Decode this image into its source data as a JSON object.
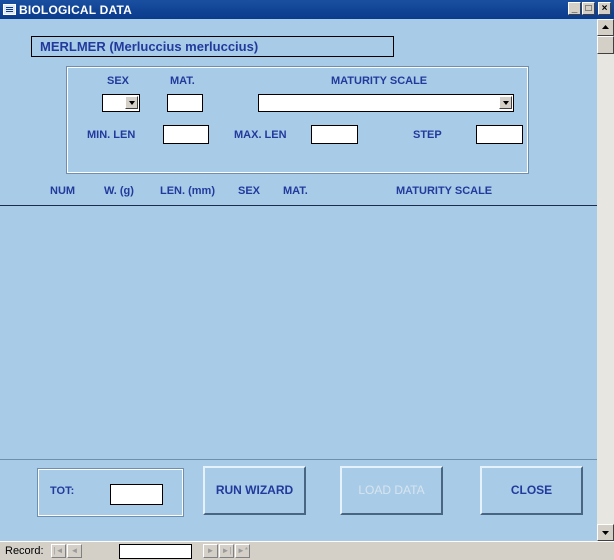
{
  "window": {
    "title": "BIOLOGICAL DATA",
    "buttons": {
      "minimize": "_",
      "maximize": "□",
      "close": "×"
    }
  },
  "species": "MERLMER (Merluccius merluccius)",
  "filters": {
    "sex_label": "SEX",
    "mat_label": "MAT.",
    "maturity_scale_label": "MATURITY SCALE",
    "min_len_label": "MIN. LEN",
    "max_len_label": "MAX. LEN",
    "step_label": "STEP",
    "sex_value": "",
    "mat_value": "",
    "maturity_scale_value": "",
    "min_len_value": "",
    "max_len_value": "",
    "step_value": ""
  },
  "table": {
    "columns": [
      "NUM",
      "W. (g)",
      "LEN. (mm)",
      "SEX",
      "MAT.",
      "MATURITY SCALE"
    ],
    "rows": []
  },
  "footer": {
    "tot_label": "TOT:",
    "tot_value": "",
    "run_wizard_label": "RUN WIZARD",
    "load_data_label": "LOAD DATA",
    "close_label": "CLOSE"
  },
  "record_nav": {
    "label": "Record:",
    "value": "",
    "first": "|◄",
    "prev": "◄",
    "next": "►",
    "last": "►|",
    "new": "►*"
  },
  "colors": {
    "background": "#a8cce8",
    "label_text": "#223a9c",
    "title_bar": "#0a3a8c",
    "disabled_text": "#d8e4ee"
  }
}
